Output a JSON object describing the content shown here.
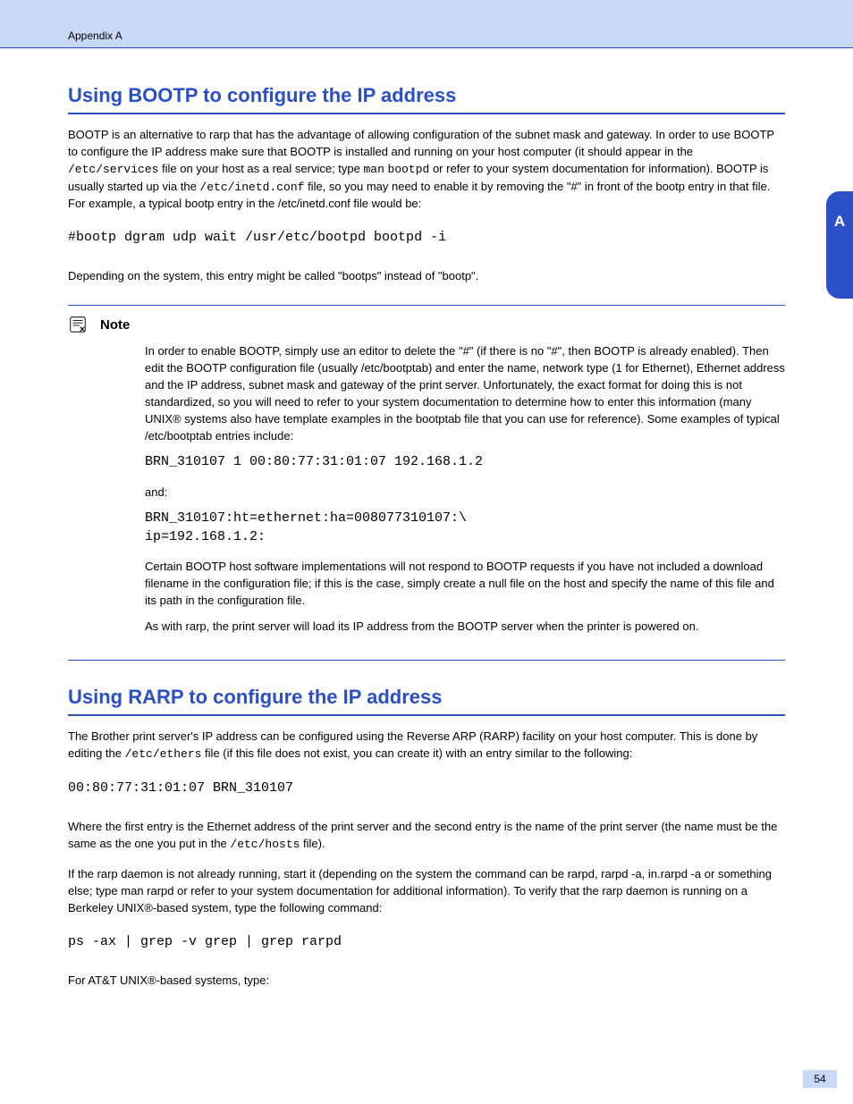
{
  "header": {
    "left": "Appendix A",
    "right": ""
  },
  "sideTab": "A",
  "section_bootp": {
    "title": "Using BOOTP to configure the IP address",
    "para1_pre": "BOOTP is an alternative to rarp that has the advantage of allowing configuration of the subnet mask and gateway. In order to use BOOTP to configure the IP address make sure that BOOTP is installed and running on your host computer (it should appear in the ",
    "file1": "/etc/services",
    "para1_mid": " file on your host as a real service; type ",
    "man": "man",
    "bootpd": "bootpd",
    "para1_mid2": " or refer to your system documentation for information). BOOTP is usually started up via the ",
    "file2": "/etc/inetd.conf",
    "para1_end": " file, so you may need to enable it by removing the \"#\" in front of the bootp entry in that file. For example, a typical bootp entry in the /etc/inetd.conf file would be:",
    "code1": "#bootp dgram udp wait /usr/etc/bootpd bootpd -i",
    "para2": "Depending on the system, this entry might be called \"bootps\" instead of \"bootp\".",
    "note": {
      "title": "Note",
      "p1": "In order to enable BOOTP, simply use an editor to delete the \"#\" (if there is no \"#\", then BOOTP is already enabled). Then edit the BOOTP configuration file (usually /etc/bootptab) and enter the name, network type (1 for Ethernet), Ethernet address and the IP address, subnet mask and gateway of the print server. Unfortunately, the exact format for doing this is not standardized, so you will need to refer to your system documentation to determine how to enter this information (many UNIX® systems also have template examples in the bootptab file that you can use for reference). Some examples of typical /etc/bootptab entries include:",
      "code1": "BRN_310107 1  00:80:77:31:01:07 192.168.1.2",
      "and": "and:",
      "code2": "BRN_310107:ht=ethernet:ha=008077310107:\\\nip=192.168.1.2:",
      "p2": "Certain BOOTP host software implementations will not respond to BOOTP requests if you have not included a download filename in the configuration file; if this is the case, simply create a null file on the host and specify the name of this file and its path in the configuration file.",
      "p3": "As with rarp, the print server will load its IP address from the BOOTP server when the printer is powered on."
    }
  },
  "section_rarp": {
    "title": "Using RARP to configure the IP address",
    "para1_pre": "The Brother print server's IP address can be configured using the Reverse ARP (RARP) facility on your host computer. This is done by editing the ",
    "file1": "/etc/ethers",
    "para1_end": " file (if this file does not exist, you can create it) with an entry similar to the following:",
    "code1": "00:80:77:31:01:07   BRN_310107",
    "para2_pre": "Where the first entry is the Ethernet address of the print server and the second entry is the name of the print server (the name must be the same as the one you put in the ",
    "file2": "/etc/hosts",
    "para2_end": " file).",
    "para3": "If the rarp daemon is not already running, start it (depending on the system the command can be rarpd, rarpd -a, in.rarpd -a or something else; type man rarpd or refer to your system documentation for additional information). To verify that the rarp daemon is running on a Berkeley UNIX®-based system, type the following command:",
    "code2": "ps -ax | grep -v grep | grep rarpd",
    "para4": "For AT&T UNIX®-based systems, type:"
  },
  "footer": {
    "page": "54"
  }
}
